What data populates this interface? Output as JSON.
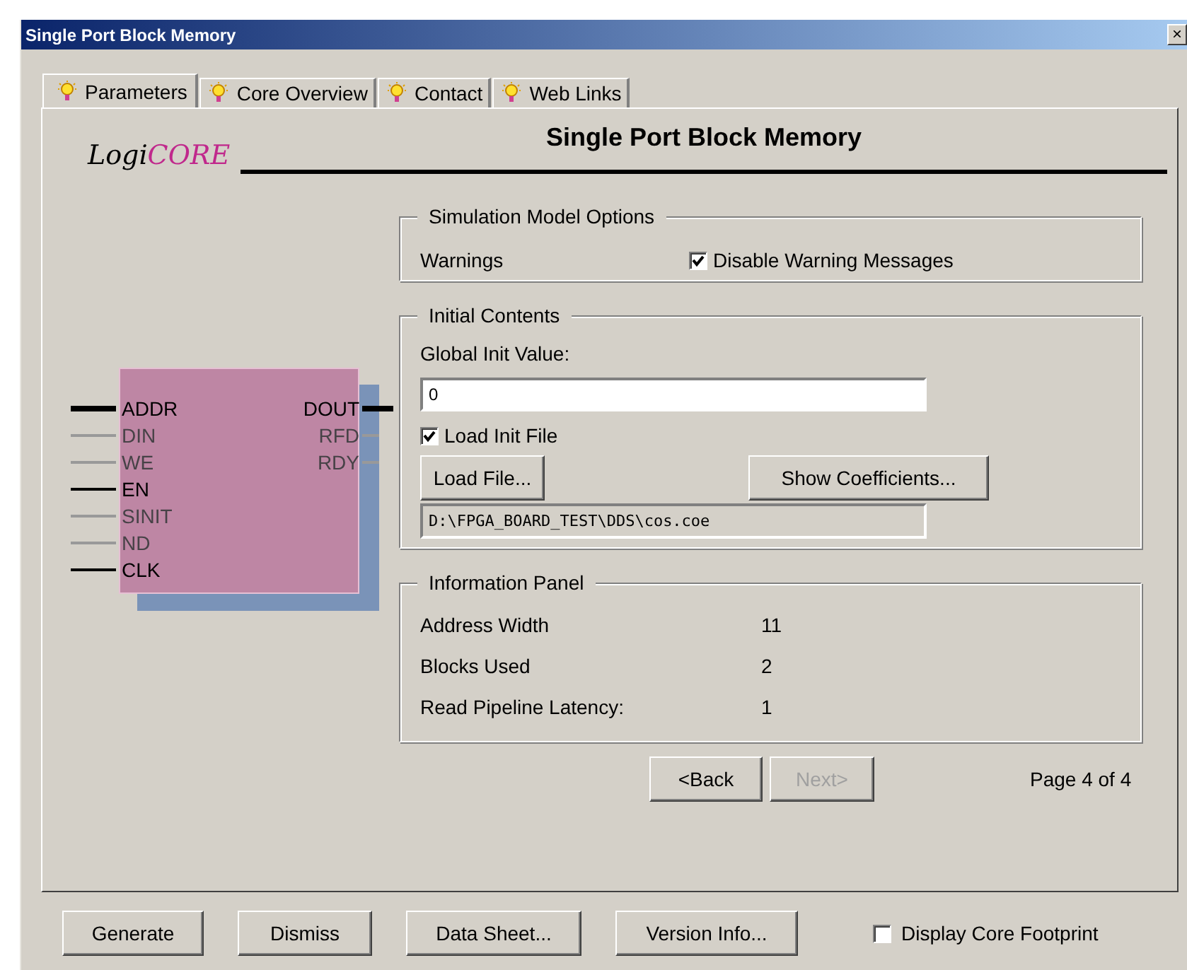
{
  "window": {
    "title": "Single Port Block Memory",
    "close": "×"
  },
  "tabs": [
    {
      "label": "Parameters",
      "selected": true
    },
    {
      "label": "Core Overview",
      "selected": false
    },
    {
      "label": "Contact",
      "selected": false
    },
    {
      "label": "Web Links",
      "selected": false
    }
  ],
  "logo": [
    "Logi",
    "CORE"
  ],
  "heading": "Single Port Block Memory",
  "symbol": {
    "inputs": [
      {
        "label": "ADDR",
        "kind": "bus"
      },
      {
        "label": "DIN",
        "kind": "unused"
      },
      {
        "label": "WE",
        "kind": "unused"
      },
      {
        "label": "EN",
        "kind": "used"
      },
      {
        "label": "SINIT",
        "kind": "unused"
      },
      {
        "label": "ND",
        "kind": "unused"
      },
      {
        "label": "CLK",
        "kind": "used"
      }
    ],
    "outputs": [
      {
        "label": "DOUT",
        "kind": "bus"
      },
      {
        "label": "RFD",
        "kind": "unused"
      },
      {
        "label": "RDY",
        "kind": "unused"
      }
    ]
  },
  "simulation": {
    "title": "Simulation Model Options",
    "label": "Warnings",
    "checkbox": {
      "label": "Disable Warning Messages",
      "checked": true
    }
  },
  "initial": {
    "title": "Initial Contents",
    "field_label": "Global Init Value:",
    "value": "0",
    "checkbox": {
      "label": "Load Init File",
      "checked": true
    },
    "load_button": "Load File...",
    "coeff_button": "Show Coefficients...",
    "file_path": "D:\\FPGA_BOARD_TEST\\DDS\\cos.coe"
  },
  "info": {
    "title": "Information Panel",
    "rows": [
      {
        "label": "Address Width",
        "value": "11"
      },
      {
        "label": "Blocks Used",
        "value": "2"
      },
      {
        "label": "Read Pipeline Latency:",
        "value": "1"
      }
    ]
  },
  "nav": {
    "back": {
      "label": "<Back",
      "disabled": false
    },
    "next": {
      "label": "Next>",
      "disabled": true
    },
    "page": "Page 4 of 4"
  },
  "buttons": [
    "Generate",
    "Dismiss",
    "Data Sheet...",
    "Version Info..."
  ],
  "footprint": {
    "label": "Display Core Footprint",
    "checked": false
  }
}
